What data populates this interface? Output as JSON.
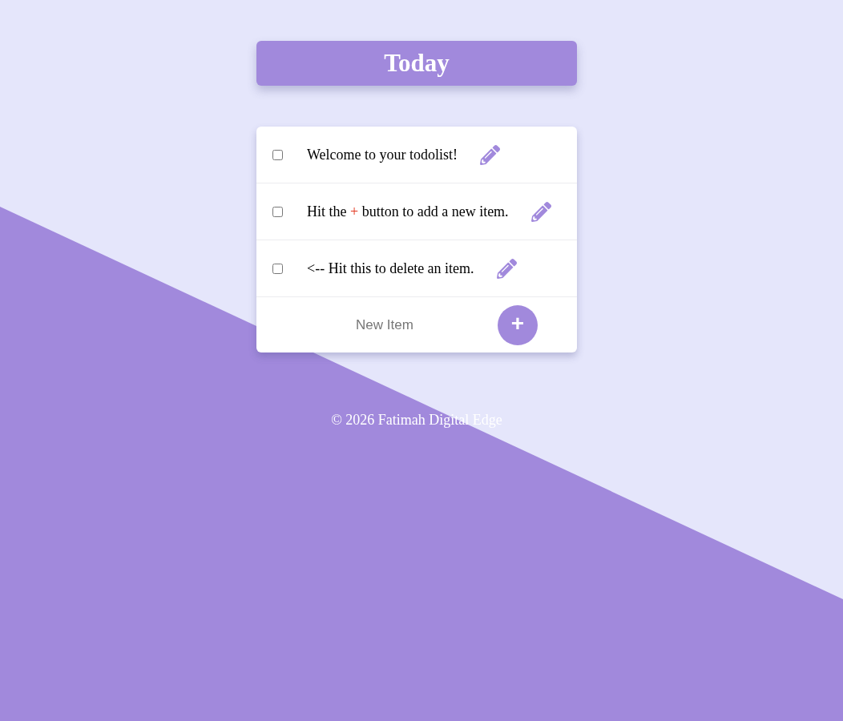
{
  "header": {
    "title": "Today"
  },
  "items": [
    {
      "checked": false,
      "parts": [
        {
          "text": "Welcome to your todolist!",
          "accent": false
        }
      ]
    },
    {
      "checked": false,
      "parts": [
        {
          "text": "Hit the ",
          "accent": false
        },
        {
          "text": "+",
          "accent": true
        },
        {
          "text": " button to add a new item.",
          "accent": false
        }
      ]
    },
    {
      "checked": false,
      "parts": [
        {
          "text": "<-- Hit this to delete an item.",
          "accent": false
        }
      ]
    }
  ],
  "new_item": {
    "placeholder": "New Item"
  },
  "add_button": {
    "label": "+"
  },
  "footer": {
    "text": "© 2026 Fatimah Digital Edge"
  }
}
